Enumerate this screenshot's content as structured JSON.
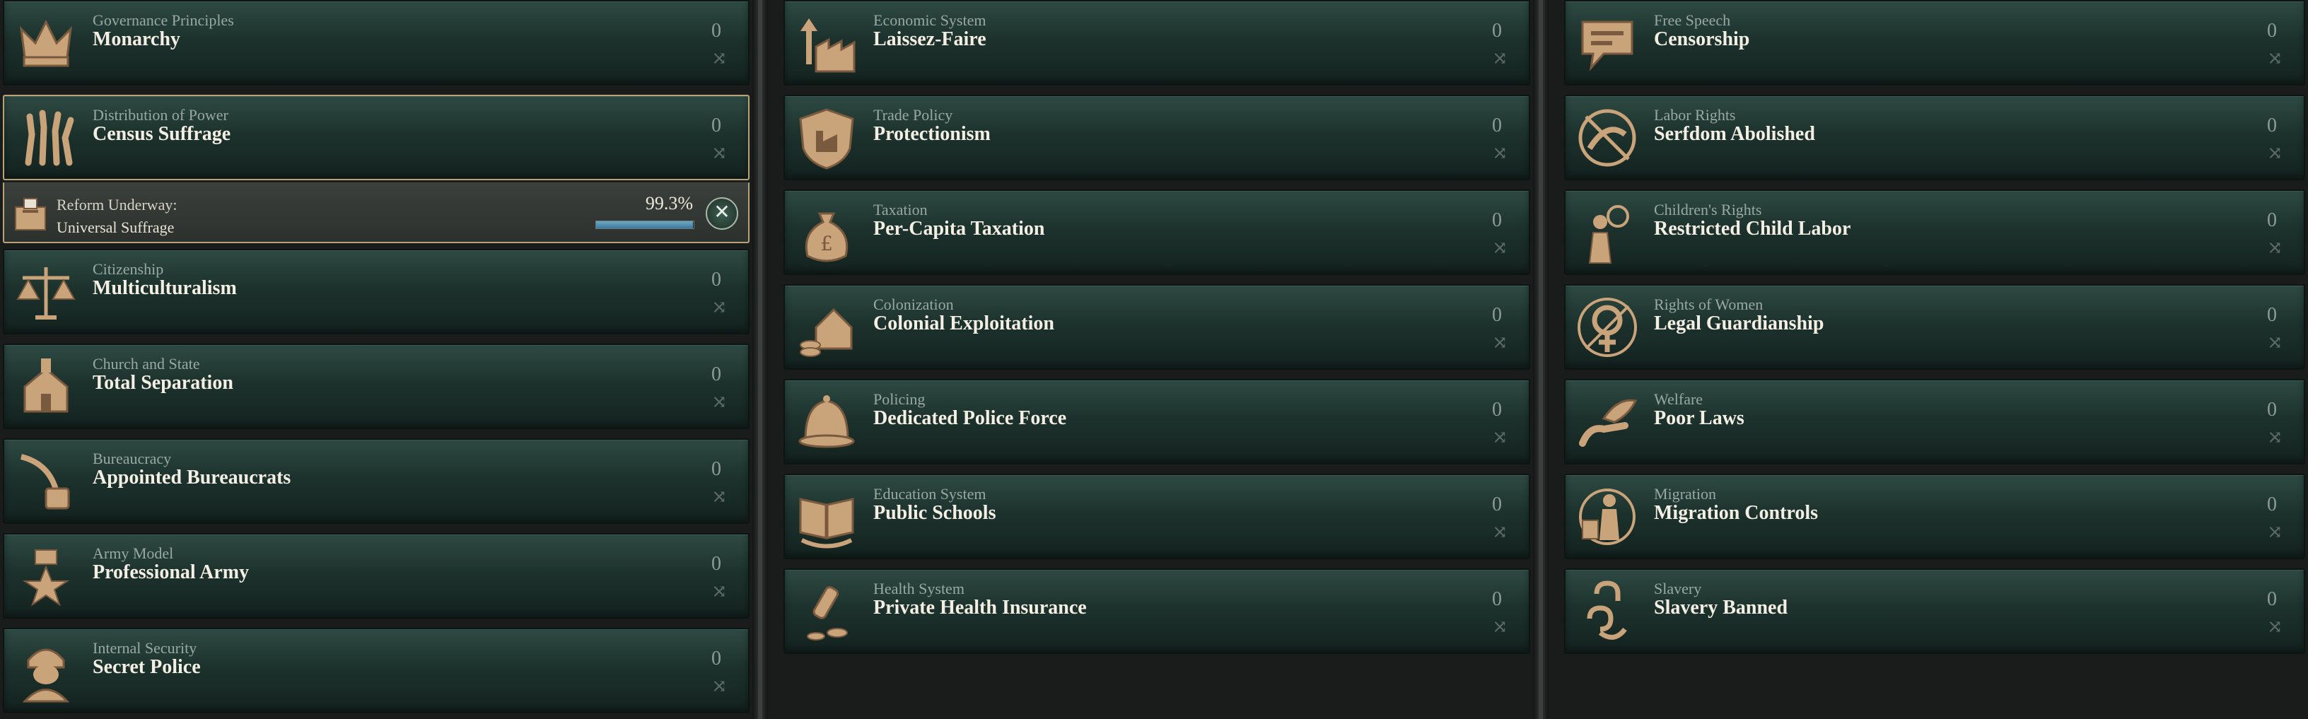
{
  "columns": [
    {
      "items": [
        {
          "category": "Governance Principles",
          "name": "Monarchy",
          "count": "0",
          "icon": "crown-icon"
        },
        {
          "category": "Distribution of Power",
          "name": "Census Suffrage",
          "count": "0",
          "icon": "raised-hands-icon"
        },
        {
          "category": "Citizenship",
          "name": "Multiculturalism",
          "count": "0",
          "icon": "scales-icon"
        },
        {
          "category": "Church and State",
          "name": "Total Separation",
          "count": "0",
          "icon": "church-icon"
        },
        {
          "category": "Bureaucracy",
          "name": "Appointed Bureaucrats",
          "count": "0",
          "icon": "quill-inkwell-icon"
        },
        {
          "category": "Army Model",
          "name": "Professional Army",
          "count": "0",
          "icon": "star-medal-icon"
        },
        {
          "category": "Internal Security",
          "name": "Secret Police",
          "count": "0",
          "icon": "hooded-agent-icon"
        }
      ],
      "reform": {
        "label": "Reform Underway:",
        "value": "Universal Suffrage",
        "percent_text": "99.3%",
        "progress": 0.993,
        "icon": "ballot-box-icon"
      }
    },
    {
      "items": [
        {
          "category": "Economic System",
          "name": "Laissez-Faire",
          "count": "0",
          "icon": "factory-arrow-icon"
        },
        {
          "category": "Trade Policy",
          "name": "Protectionism",
          "count": "0",
          "icon": "factory-shield-icon"
        },
        {
          "category": "Taxation",
          "name": "Per-Capita Taxation",
          "count": "0",
          "icon": "money-bag-icon"
        },
        {
          "category": "Colonization",
          "name": "Colonial Exploitation",
          "count": "0",
          "icon": "house-coins-icon"
        },
        {
          "category": "Policing",
          "name": "Dedicated Police Force",
          "count": "0",
          "icon": "police-helmet-icon"
        },
        {
          "category": "Education System",
          "name": "Public Schools",
          "count": "0",
          "icon": "open-book-icon"
        },
        {
          "category": "Health System",
          "name": "Private Health Insurance",
          "count": "0",
          "icon": "medicine-coins-icon"
        }
      ]
    },
    {
      "items": [
        {
          "category": "Free Speech",
          "name": "Censorship",
          "count": "0",
          "icon": "speech-bubble-icon"
        },
        {
          "category": "Labor Rights",
          "name": "Serfdom Abolished",
          "count": "0",
          "icon": "broken-chains-icon"
        },
        {
          "category": "Children's Rights",
          "name": "Restricted Child Labor",
          "count": "0",
          "icon": "child-clock-icon"
        },
        {
          "category": "Rights of Women",
          "name": "Legal Guardianship",
          "count": "0",
          "icon": "venus-symbol-icon"
        },
        {
          "category": "Welfare",
          "name": "Poor Laws",
          "count": "0",
          "icon": "bread-hand-icon"
        },
        {
          "category": "Migration",
          "name": "Migration Controls",
          "count": "0",
          "icon": "migrant-figure-icon"
        },
        {
          "category": "Slavery",
          "name": "Slavery Banned",
          "count": "0",
          "icon": "broken-shackle-icon"
        }
      ]
    }
  ],
  "swap_glyph": "⤨",
  "cancel_glyph": "✕",
  "colors": {
    "card_top": "#2e4a43",
    "card_bottom": "#14231f",
    "selected_border": "#b8a276",
    "progress_fill": "#3c78a0",
    "icon_gold": "#c9a37a"
  }
}
